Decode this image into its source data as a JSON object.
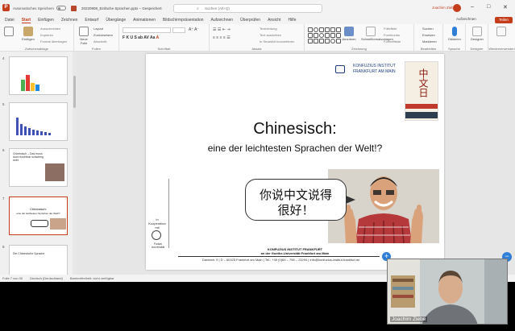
{
  "titlebar": {
    "autosave_label": "Automatisches Speichern",
    "document_name": "20220908_Einfache Sprachen.pptx – Gespeichert",
    "search_placeholder": "Suchen (Alt+Q)",
    "user_name": "Joachim Ziebe",
    "icons": [
      "powerpoint-logo",
      "save-icon",
      "undo-icon",
      "minimize-icon",
      "maximize-icon",
      "close-icon"
    ]
  },
  "menu_tabs": [
    "Datei",
    "Start",
    "Einfügen",
    "Zeichnen",
    "Entwurf",
    "Übergänge",
    "Animationen",
    "Bildschirmpräsentation",
    "Aufzeichnen",
    "Überprüfen",
    "Ansicht",
    "Hilfe"
  ],
  "active_tab": "Start",
  "tab_right": {
    "record_label": "Aufzeichnen",
    "share_label": "Teilen"
  },
  "ribbon": {
    "clipboard": {
      "paste_label": "Einfügen",
      "cut": "Ausschneiden",
      "copy": "Kopieren",
      "format_painter": "Format übertragen",
      "group_label": "Zwischenablage"
    },
    "slides": {
      "new_slide": "Neue Folie",
      "layout": "Layout",
      "reset": "Zurücksetzen",
      "section": "Abschnitt",
      "group_label": "Folien"
    },
    "font": {
      "group_label": "Schriftart"
    },
    "paragraph": {
      "text_direction": "Textrichtung",
      "align_text": "Text ausrichten",
      "smartart": "In SmartArt konvertieren",
      "group_label": "Absatz"
    },
    "drawing": {
      "arrange": "Anordnen",
      "quick_styles": "Schnellformatvorlagen",
      "fill": "Fülleffekt",
      "outline": "Formkontur",
      "effects": "Formeffekte",
      "group_label": "Zeichnung"
    },
    "editing": {
      "find": "Suchen",
      "replace": "Ersetzen",
      "select": "Markieren",
      "group_label": "Bearbeiten"
    },
    "voice": {
      "dictate": "Diktieren",
      "group_label": "Sprache"
    },
    "designer": {
      "label": "Designer",
      "group_label": "Designer"
    },
    "reuse_label": "Wiederverwenden"
  },
  "thumbnails": [
    {
      "number": "4"
    },
    {
      "number": "5"
    },
    {
      "number": "6",
      "text": "Chinesisch – Das muss doch furchtbar schwierig sein!"
    },
    {
      "number": "7",
      "title": "Chinesisch:",
      "subtitle": "eine der leichtesten Sprachen der Welt!?",
      "selected": true
    },
    {
      "number": "8",
      "text": "Die Chinesische Sprache"
    }
  ],
  "slide": {
    "title": "Chinesisch:",
    "subtitle": "eine der leichtesten Sprachen der Welt!?",
    "logo_line1": "KONFUZIUS INSTITUT",
    "logo_line2": "FRANKFURT AM MAIN",
    "bubble_line1": "你说中文说得",
    "bubble_line2": "很好！",
    "book_chars": "中文日",
    "coop_text": "In Kooperation mit",
    "fudan_text": "Fudan Universität",
    "footer_title": "KONFUZIUS INSTITUT FRANKFURT",
    "footer_sub": "an der Goethe-Universität Frankfurt am Main",
    "footer_address": "Dantestr. 9 | D – 60325 Frankfurt am Main | Tel.: +49 (0)69 – 798 – 23294 | info@konfuzius-institut-frankfurt.de"
  },
  "statusbar": {
    "slide_info": "Folie 7 von 30",
    "language": "Deutsch (Deutschland)",
    "accessibility": "Barrierefreiheit: nicht verfügbar"
  },
  "video": {
    "participant_name": "Joachim Ziebe"
  },
  "colors": {
    "accent": "#c43e1c",
    "ki_blue": "#1a3a7a",
    "teams_blue": "#2f7fd6"
  }
}
